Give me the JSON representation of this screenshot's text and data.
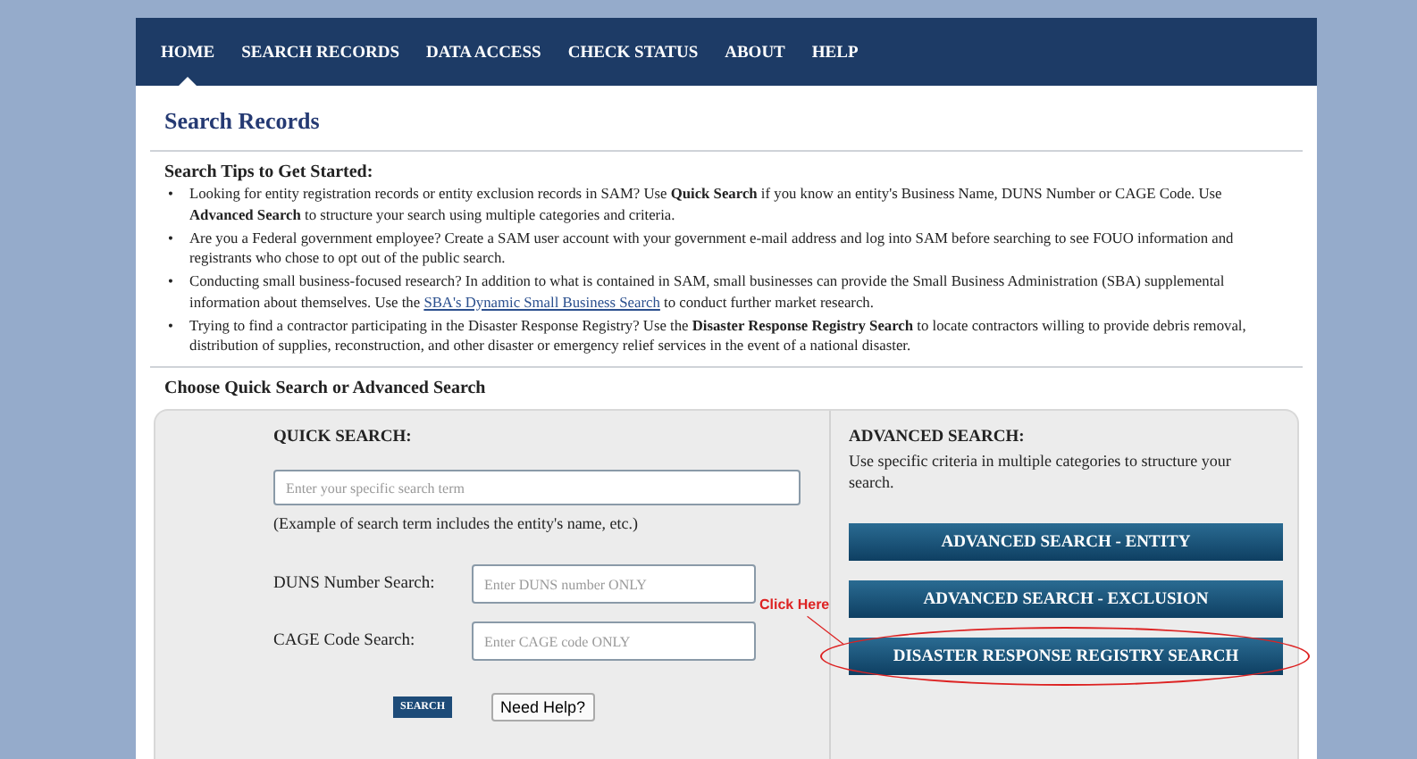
{
  "nav": {
    "items": [
      {
        "label": "HOME",
        "selected": true
      },
      {
        "label": "SEARCH RECORDS",
        "selected": false
      },
      {
        "label": "DATA ACCESS",
        "selected": false
      },
      {
        "label": "CHECK STATUS",
        "selected": false
      },
      {
        "label": "ABOUT",
        "selected": false
      },
      {
        "label": "HELP",
        "selected": false
      }
    ]
  },
  "page_title": "Search Records",
  "tips": {
    "heading": "Search Tips to Get Started:",
    "items": [
      {
        "marker": "•",
        "parts": [
          {
            "kind": "text",
            "text": "Looking for entity registration records or entity exclusion records in SAM? Use **Quick Search** if you know an entity's Business Name, DUNS Number or CAGE Code. Use **Advanced Search** to structure your search using multiple categories and criteria."
          }
        ]
      },
      {
        "marker": "•",
        "parts": [
          {
            "kind": "text",
            "text": "Are you a Federal government employee? Create a SAM user account with your government e-mail address and log into SAM before searching to see FOUO information and registrants who chose to opt out of the public search."
          }
        ]
      },
      {
        "marker": "•",
        "parts": [
          {
            "kind": "text",
            "text": "Conducting small business-focused research? In addition to what is contained in SAM, small businesses can provide the Small Business Administration (SBA) supplemental information about themselves. Use the "
          },
          {
            "kind": "link",
            "text": "SBA's Dynamic Small Business Search"
          },
          {
            "kind": "text",
            "text": " to conduct further market research."
          }
        ]
      },
      {
        "marker": "•",
        "parts": [
          {
            "kind": "text",
            "text": "Trying to find a contractor participating in the Disaster Response Registry? Use the **Disaster Response Registry Search** to locate contractors willing to provide debris removal, distribution of supplies, reconstruction, and other disaster or emergency relief services in the event of a national disaster."
          }
        ]
      }
    ]
  },
  "choose_heading": "Choose Quick Search or Advanced Search",
  "quick_search": {
    "heading": "QUICK SEARCH:",
    "search_field": {
      "placeholder": "Enter your specific search term"
    },
    "example": "(Example of search term includes the entity's name, etc.)",
    "fields": [
      {
        "label": "DUNS Number Search:",
        "placeholder": "Enter DUNS number ONLY"
      },
      {
        "label": "CAGE Code Search:",
        "placeholder": "Enter CAGE code ONLY"
      }
    ],
    "search_button": "SEARCH",
    "help_button": "Need Help?"
  },
  "advanced_search": {
    "heading": "ADVANCED SEARCH:",
    "description": "Use specific criteria in multiple categories to structure your search.",
    "buttons": [
      {
        "label": "ADVANCED SEARCH - ENTITY",
        "highlighted": false
      },
      {
        "label": "ADVANCED SEARCH - EXCLUSION",
        "highlighted": false
      },
      {
        "label": "DISASTER RESPONSE REGISTRY SEARCH",
        "highlighted": true
      }
    ]
  },
  "annotation": {
    "text": "Click Here"
  }
}
